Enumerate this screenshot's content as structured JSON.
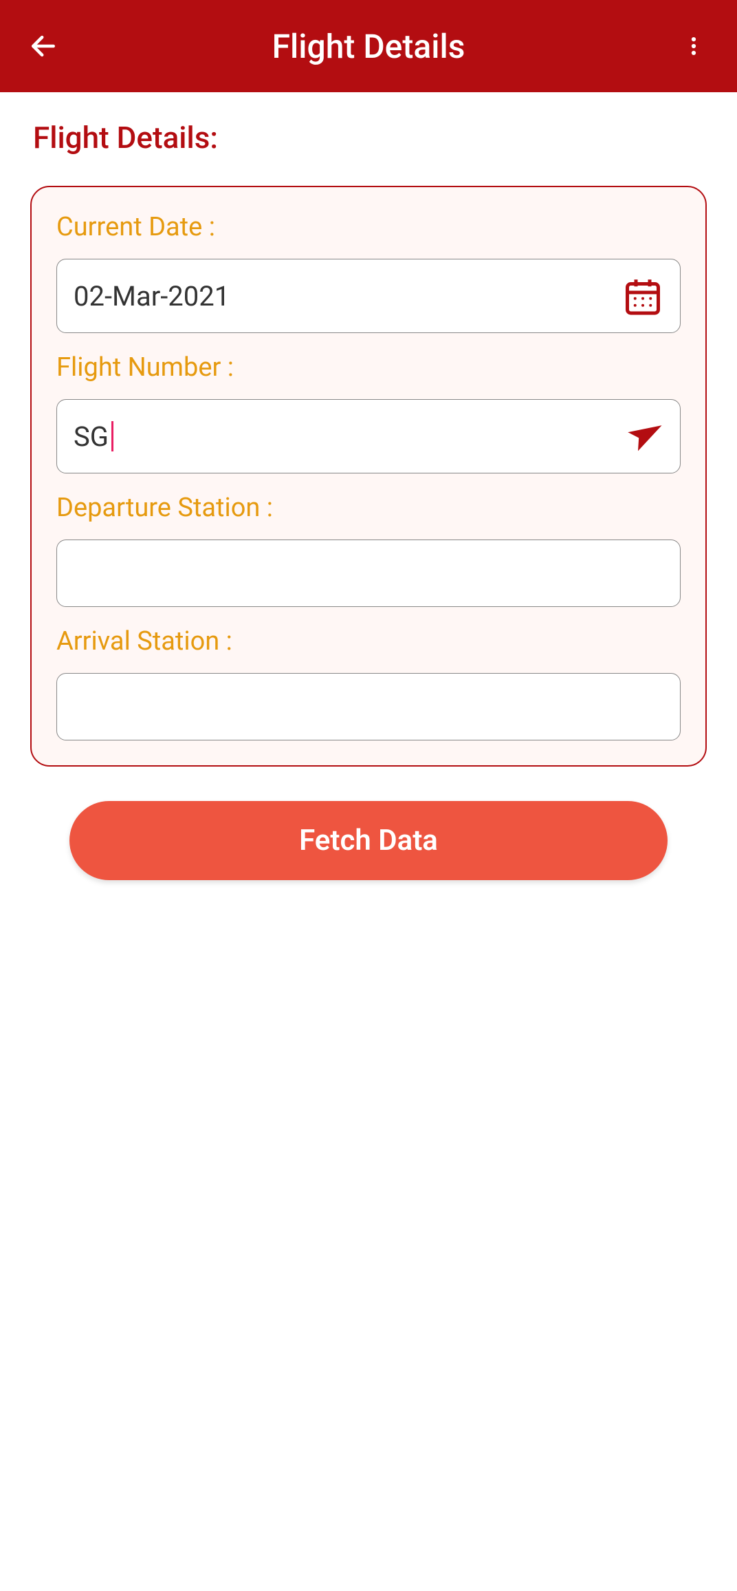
{
  "header": {
    "title": "Flight Details"
  },
  "section": {
    "title": "Flight Details:"
  },
  "form": {
    "current_date": {
      "label": "Current Date :",
      "value": "02-Mar-2021"
    },
    "flight_number": {
      "label": "Flight Number :",
      "prefix": "SG"
    },
    "departure_station": {
      "label": "Departure Station :",
      "value": ""
    },
    "arrival_station": {
      "label": "Arrival Station :",
      "value": ""
    }
  },
  "actions": {
    "fetch_label": "Fetch Data"
  }
}
